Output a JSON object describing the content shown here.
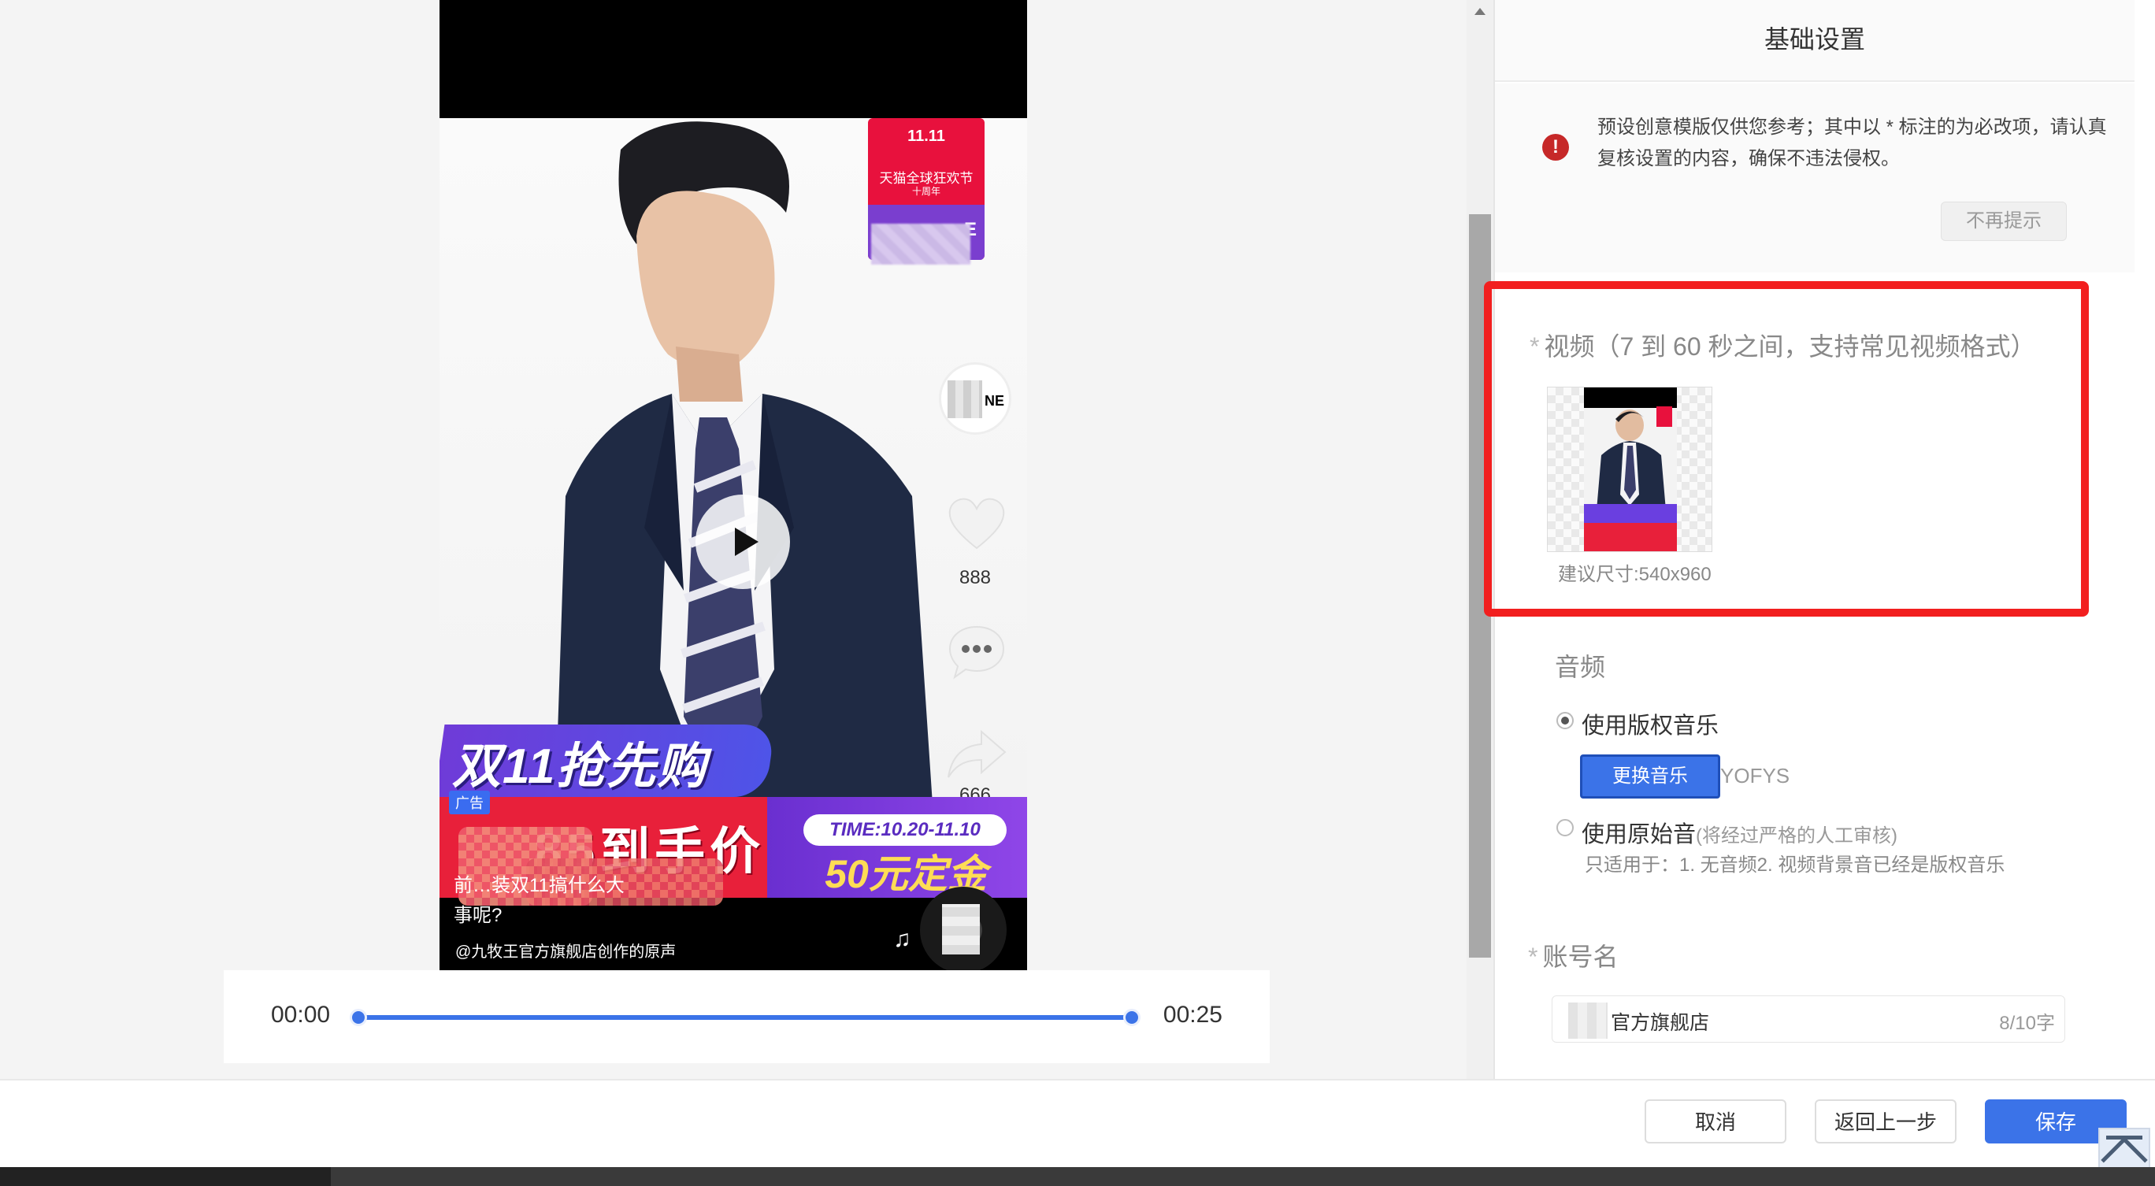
{
  "preview": {
    "tmall_badge": {
      "logo": "11.11",
      "text": "天猫全球狂欢节",
      "sub": "十周年",
      "letter": "E"
    },
    "avatar_text": "NE",
    "like_count": "888",
    "share_count": "666",
    "promo_title": "双11抢先购",
    "ad_tag": "广告",
    "price_text": "85到手价",
    "time_pill": "TIME:10.20-11.10",
    "deposit": "50元定金",
    "overlay_line1": "前…装双11搞什么大",
    "overlay_line2": "事呢?",
    "caption": "@九牧王官方旗舰店创作的原声",
    "icons": [
      "play-icon",
      "heart-icon",
      "comment-icon",
      "share-icon",
      "music-note-icon"
    ]
  },
  "timeline": {
    "start": "00:00",
    "end": "00:25",
    "progress": 1.0
  },
  "panel": {
    "title": "基础设置",
    "notice": "预设创意模版仅供您参考；其中以 * 标注的为必改项，请认真复核设置的内容，确保不违法侵权。",
    "dismiss": "不再提示",
    "video_label": "视频（7 到 60 秒之间，支持常见视频格式）",
    "video_hint": "建议尺寸:540x960",
    "audio_label": "音频",
    "option_licensed": "使用版权音乐",
    "change_music": "更换音乐",
    "music_name": "YOFYS",
    "option_original": "使用原始音",
    "option_original_note": "(将经过严格的人工审核)",
    "use_note": "只适用于：1. 无音频2. 视频背景音已经是版权音乐",
    "account_label": "账号名",
    "account_value": "官方旗舰店",
    "account_count": "8/10字",
    "selected_audio": "licensed"
  },
  "footer": {
    "cancel": "取消",
    "back": "返回上一步",
    "save": "保存"
  },
  "colors": {
    "accent": "#3b73e8",
    "highlight_border": "#f21f1f",
    "warning": "#c62828"
  }
}
